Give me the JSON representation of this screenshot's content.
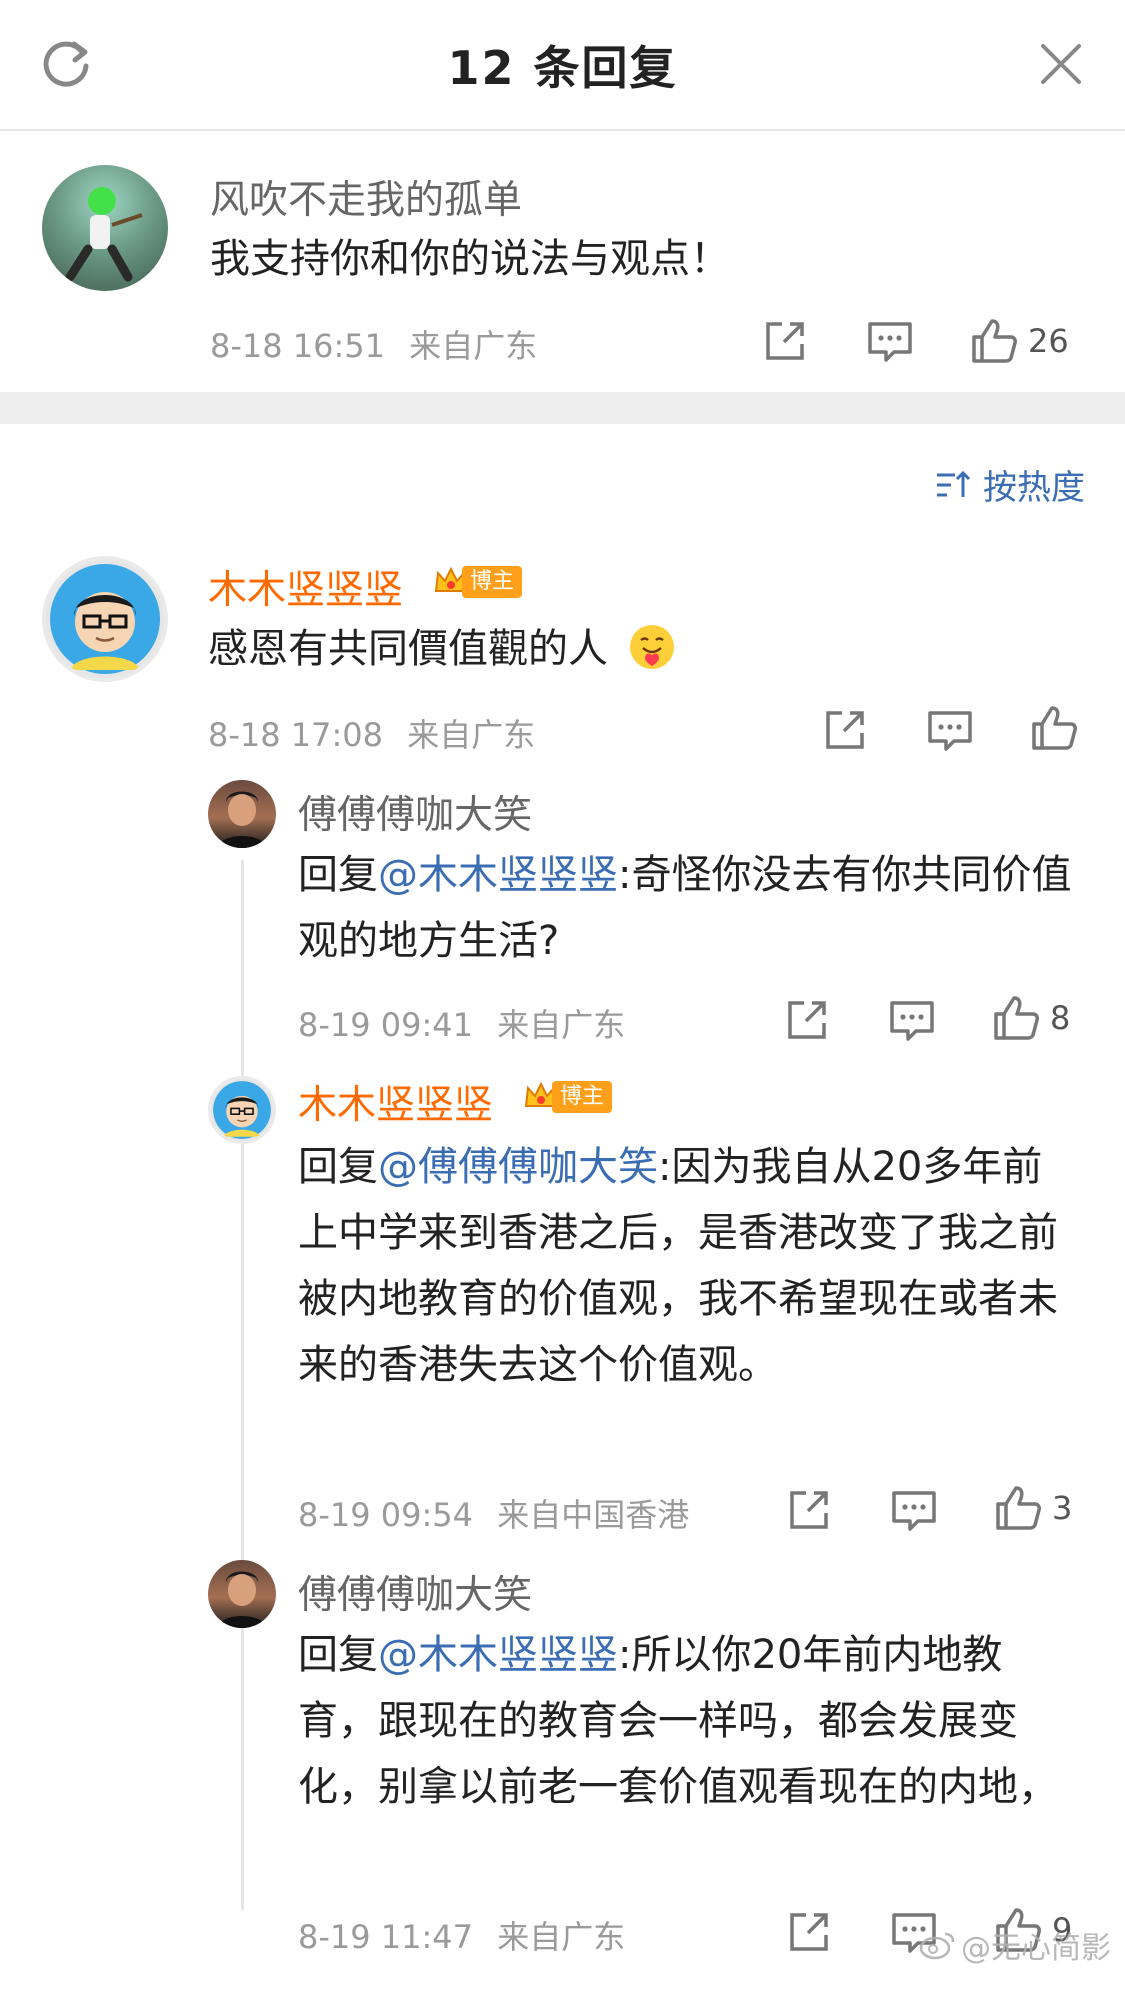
{
  "header": {
    "title": "12 条回复",
    "refresh_icon": "refresh-icon",
    "close_icon": "close-icon"
  },
  "main_comment": {
    "user": "风吹不走我的孤单",
    "text": "我支持你和你的说法与观点！",
    "time": "8-18 16:51",
    "location": "来自广东",
    "likes": "26"
  },
  "sort": {
    "label": "按热度"
  },
  "replies": [
    {
      "user": "木木竖竖竖",
      "badge": "博主",
      "text": "感恩有共同價值觀的人",
      "emoji": "hug-emoji",
      "time": "8-18 17:08",
      "location": "来自广东",
      "likes": ""
    },
    {
      "user": "傅傅傅咖大笑",
      "reply_prefix": "回复",
      "mention": "@木木竖竖竖",
      "text": ":奇怪你没去有你共同价值观的地方生活?",
      "time": "8-19 09:41",
      "location": "来自广东",
      "likes": "8"
    },
    {
      "user": "木木竖竖竖",
      "badge": "博主",
      "reply_prefix": "回复",
      "mention": "@傅傅傅咖大笑",
      "text": ":因为我自从20多年前上中学来到香港之后，是香港改变了我之前被内地教育的价值观，我不希望现在或者未来的香港失去这个价值观。",
      "time": "8-19 09:54",
      "location": "来自中国香港",
      "likes": "3"
    },
    {
      "user": "傅傅傅咖大笑",
      "reply_prefix": "回复",
      "mention": "@木木竖竖竖",
      "text": ":所以你20年前内地教育，跟现在的教育会一样吗，都会发展变化，别拿以前老一套价值观看现在的内地，",
      "time": "8-19 11:47",
      "location": "来自广东",
      "likes": "9"
    }
  ],
  "watermark": "@无心简影",
  "colors": {
    "orange_name": "#ff6a00",
    "mention_blue": "#3b6db3",
    "badge": "#ff9f1a",
    "gray_text": "#9a9a9a"
  }
}
